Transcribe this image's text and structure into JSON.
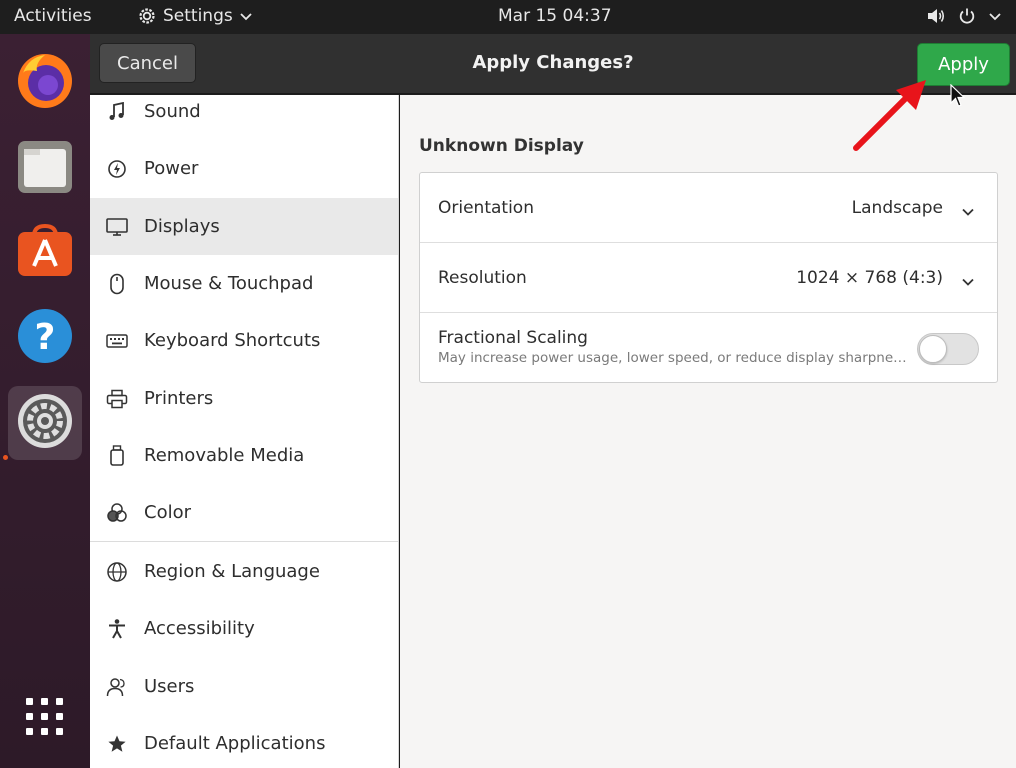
{
  "topbar": {
    "activities": "Activities",
    "app_name": "Settings",
    "clock": "Mar 15  04:37"
  },
  "dock": {
    "items": [
      "firefox-icon",
      "files-icon",
      "software-icon",
      "help-icon",
      "settings-icon",
      "app-grid-icon"
    ]
  },
  "header": {
    "cancel_label": "Cancel",
    "title": "Apply Changes?",
    "apply_label": "Apply"
  },
  "sidebar": {
    "items": [
      {
        "label": "Sound",
        "icon": "music-note-icon"
      },
      {
        "label": "Power",
        "icon": "power-icon"
      },
      {
        "label": "Displays",
        "icon": "display-icon",
        "selected": true
      },
      {
        "label": "Mouse & Touchpad",
        "icon": "mouse-icon"
      },
      {
        "label": "Keyboard Shortcuts",
        "icon": "keyboard-icon"
      },
      {
        "label": "Printers",
        "icon": "printer-icon"
      },
      {
        "label": "Removable Media",
        "icon": "removable-media-icon"
      },
      {
        "label": "Color",
        "icon": "color-icon"
      },
      {
        "label": "Region & Language",
        "icon": "globe-icon"
      },
      {
        "label": "Accessibility",
        "icon": "accessibility-icon"
      },
      {
        "label": "Users",
        "icon": "users-icon"
      },
      {
        "label": "Default Applications",
        "icon": "star-icon"
      }
    ]
  },
  "main": {
    "section_title": "Unknown Display",
    "orientation": {
      "label": "Orientation",
      "value": "Landscape"
    },
    "resolution": {
      "label": "Resolution",
      "value": "1024 × 768 (4:3)"
    },
    "fractional_scaling": {
      "label": "Fractional Scaling",
      "description": "May increase power usage, lower speed, or reduce display sharpness.",
      "enabled": false
    }
  },
  "colors": {
    "apply_button": "#2fa84a",
    "annotation_arrow": "#e8141b",
    "dock_accent": "#e95420"
  }
}
